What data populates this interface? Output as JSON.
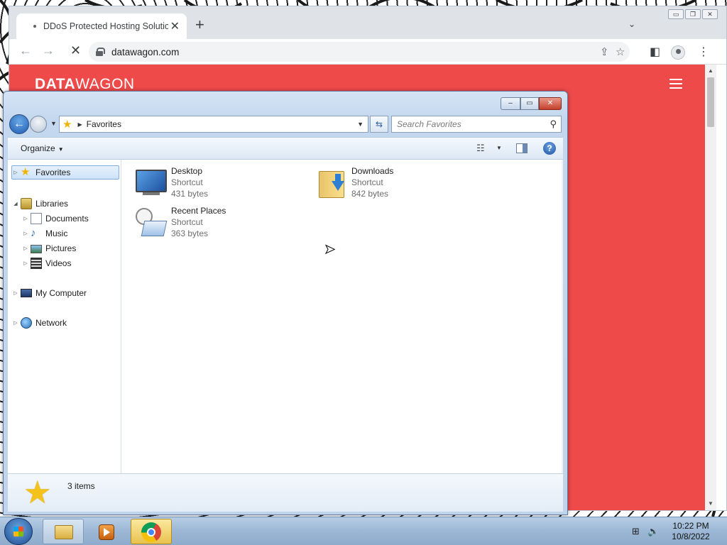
{
  "browser": {
    "tab_title": "DDoS Protected Hosting Solutions",
    "tab_close": "✕",
    "new_tab": "+",
    "tab_list": "⌄",
    "url": "datawagon.com",
    "window_controls": {
      "minimize": "▭",
      "restore": "❐",
      "close": "✕"
    }
  },
  "site": {
    "brand_bold": "DATA",
    "brand_light": "WAGON",
    "background_color": "#ef4a4a"
  },
  "explorer": {
    "caption": {
      "minimize": "–",
      "maximize": "▭",
      "close": "✕"
    },
    "address_crumb": "Favorites",
    "search_placeholder": "Search Favorites",
    "organize_label": "Organize",
    "help_label": "?",
    "nav": {
      "favorites": "Favorites",
      "libraries": "Libraries",
      "documents": "Documents",
      "music": "Music",
      "pictures": "Pictures",
      "videos": "Videos",
      "my_computer": "My Computer",
      "network": "Network"
    },
    "items": [
      {
        "name": "Desktop",
        "type": "Shortcut",
        "size": "431 bytes"
      },
      {
        "name": "Downloads",
        "type": "Shortcut",
        "size": "842 bytes"
      },
      {
        "name": "Recent Places",
        "type": "Shortcut",
        "size": "363 bytes"
      }
    ],
    "status_count": "3 items"
  },
  "taskbar": {
    "time": "10:22 PM",
    "date": "10/8/2022"
  }
}
